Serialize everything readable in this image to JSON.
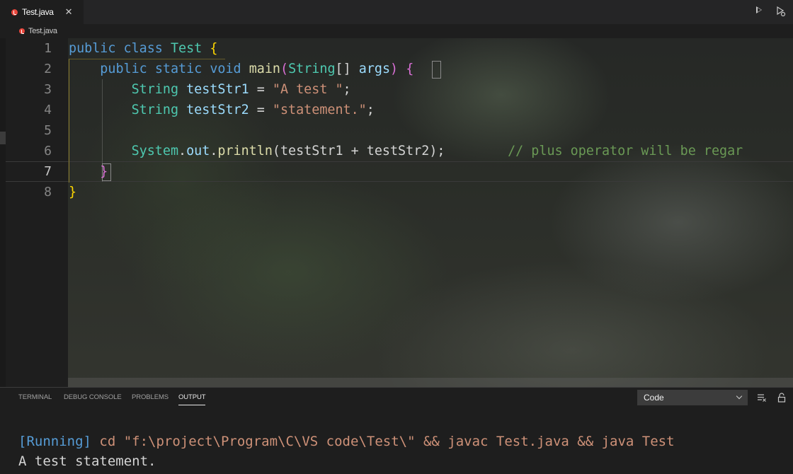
{
  "tab": {
    "label": "Test.java",
    "close": "✕"
  },
  "breadcrumb": {
    "label": "Test.java"
  },
  "editor": {
    "line_numbers": [
      "1",
      "2",
      "3",
      "4",
      "5",
      "6",
      "7",
      "8"
    ],
    "code": {
      "l1_public": "public",
      "l1_class": "class",
      "l1_name": "Test",
      "l1_brace": "{",
      "l2_public": "public",
      "l2_static": "static",
      "l2_void": "void",
      "l2_main": "main",
      "l2_paren_open": "(",
      "l2_string": "String",
      "l2_array": "[]",
      "l2_args": "args",
      "l2_paren_close": ")",
      "l2_brace": "{",
      "l3_type": "String",
      "l3_var": "testStr1",
      "l3_eq": " = ",
      "l3_str": "\"A test \"",
      "l3_semi": ";",
      "l4_type": "String",
      "l4_var": "testStr2",
      "l4_eq": " = ",
      "l4_str": "\"statement.\"",
      "l4_semi": ";",
      "l6_system": "System",
      "l6_dot1": ".",
      "l6_out": "out",
      "l6_dot2": ".",
      "l6_println": "println",
      "l6_args": "(testStr1 + testStr2);",
      "l6_comment": "// plus operator will be regar",
      "l7_brace": "}",
      "l8_brace": "}"
    }
  },
  "panel": {
    "tabs": [
      "TERMINAL",
      "DEBUG CONSOLE",
      "PROBLEMS",
      "OUTPUT"
    ],
    "active_tab": "OUTPUT",
    "dropdown_value": "Code",
    "output": {
      "running_tag": "[Running]",
      "command": " cd \"f:\\project\\Program\\C\\VS code\\Test\\\" && javac Test.java && java Test",
      "result": "A test statement."
    }
  },
  "colors": {
    "keyword": "#569cd6",
    "type": "#4ec9b0",
    "function": "#dcdcaa",
    "variable": "#9cdcfe",
    "string": "#ce9178",
    "comment": "#6a9955",
    "java_icon": "#e8463c"
  },
  "icons": [
    "java-file-icon",
    "close-icon",
    "run-icon",
    "debug-run-icon",
    "chevron-down-icon",
    "clear-output-icon",
    "lock-icon"
  ]
}
